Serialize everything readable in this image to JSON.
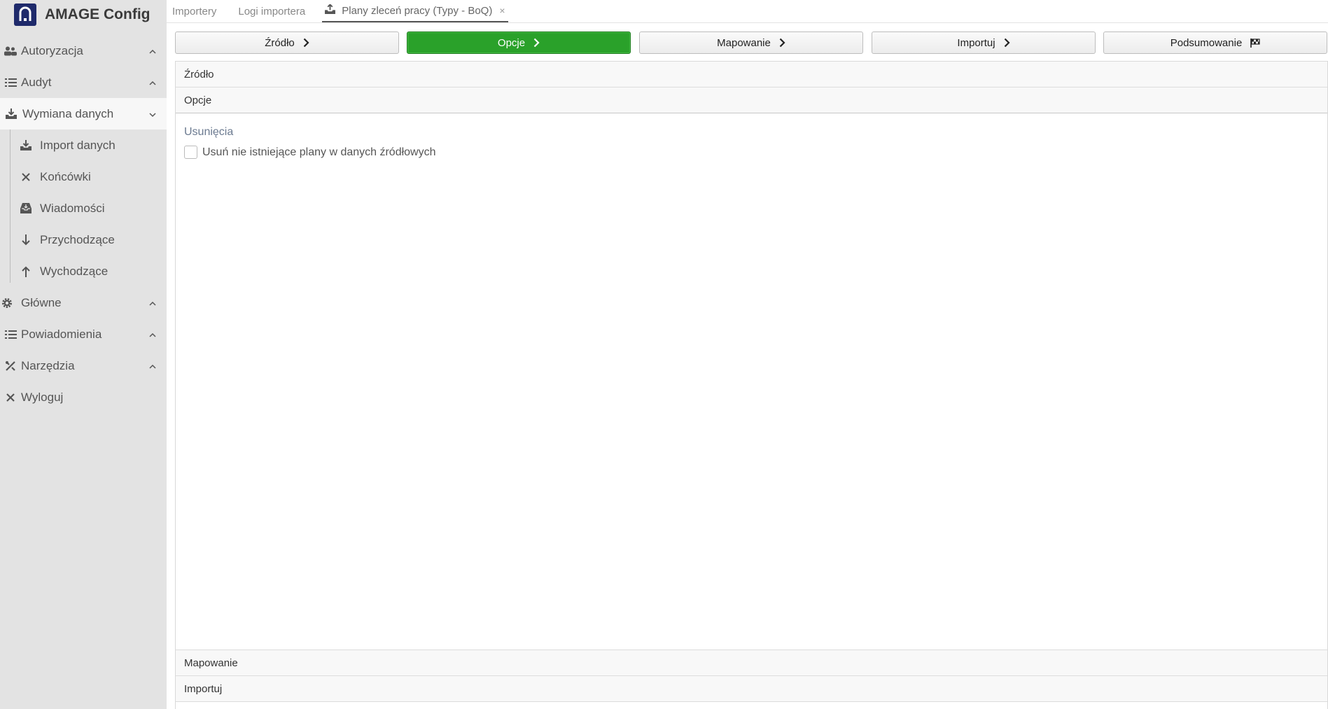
{
  "app": {
    "title": "AMAGE Config"
  },
  "sidebar": {
    "items": [
      {
        "label": "Autoryzacja",
        "icon": "users-icon"
      },
      {
        "label": "Audyt",
        "icon": "list-icon"
      },
      {
        "label": "Wymiana danych",
        "icon": "download-tray-icon"
      },
      {
        "label": "Główne",
        "icon": "gear-icon"
      },
      {
        "label": "Powiadomienia",
        "icon": "list-icon"
      },
      {
        "label": "Narzędzia",
        "icon": "tools-icon"
      },
      {
        "label": "Wyloguj",
        "icon": "close-icon"
      }
    ],
    "subitems": [
      {
        "label": "Import danych",
        "icon": "download-tray-icon"
      },
      {
        "label": "Końcówki",
        "icon": "cross-arrows-icon"
      },
      {
        "label": "Wiadomości",
        "icon": "inbox-icon"
      },
      {
        "label": "Przychodzące",
        "icon": "arrow-down-icon"
      },
      {
        "label": "Wychodzące",
        "icon": "arrow-up-icon"
      }
    ]
  },
  "tabs": [
    {
      "label": "Importery"
    },
    {
      "label": "Logi importera"
    },
    {
      "label": "Plany zleceń pracy (Typy - BoQ)",
      "close": "×"
    }
  ],
  "steps": [
    {
      "label": "Źródło"
    },
    {
      "label": "Opcje"
    },
    {
      "label": "Mapowanie"
    },
    {
      "label": "Importuj"
    },
    {
      "label": "Podsumowanie"
    }
  ],
  "accordion": {
    "source": "Źródło",
    "options": "Opcje",
    "mapping": "Mapowanie",
    "import": "Importuj"
  },
  "options_panel": {
    "section_title": "Usunięcia",
    "checkbox_label": "Usuń nie istniejące plany w danych źródłowych",
    "checkbox_checked": false
  },
  "colors": {
    "accent": "#2aa12a",
    "brand": "#1f2a6b",
    "sidebar": "#e3e3e3"
  }
}
